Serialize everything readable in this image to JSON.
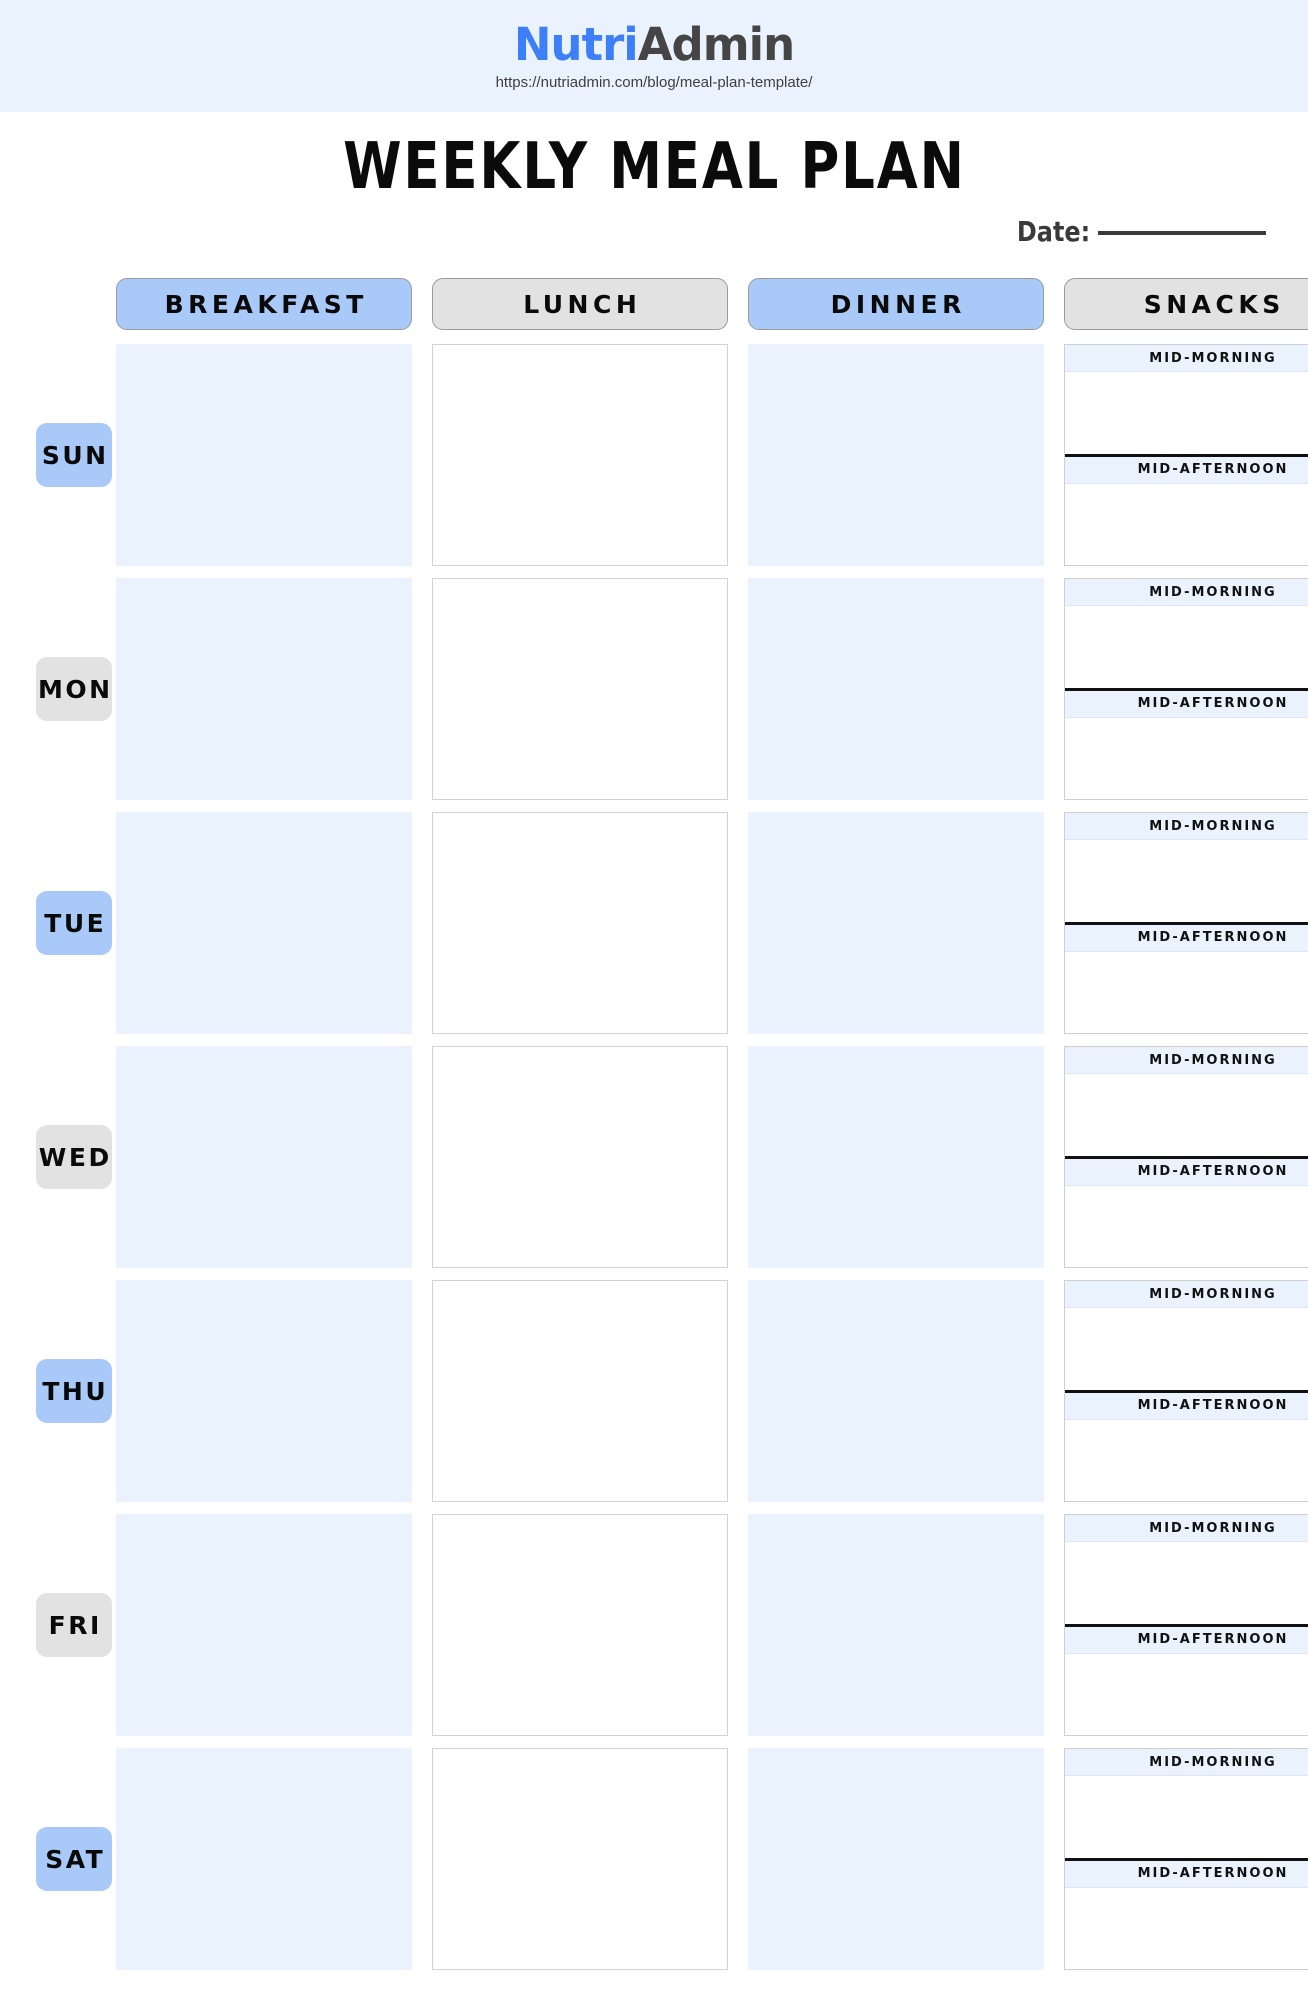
{
  "banner": {
    "brand_first": "Nutri",
    "brand_second": "Admin",
    "url": "https://nutriadmin.com/blog/meal-plan-template/",
    "background_color": "#eaf2fd",
    "brand_color": "#3d7ff9",
    "brand_second_color": "#454545"
  },
  "title": "WEEKLY MEAL PLAN",
  "date_field": {
    "label": "Date:",
    "value": "",
    "placeholder": ""
  },
  "colors": {
    "accent_blue": "#a9c9f8",
    "cell_blue": "#eaf2fd",
    "accent_gray": "#e2e2e2",
    "divider_dark": "#111111"
  },
  "columns": [
    {
      "label": "BREAKFAST",
      "style": "blue",
      "cell_style": "blue"
    },
    {
      "label": "LUNCH",
      "style": "gray",
      "cell_style": "white"
    },
    {
      "label": "DINNER",
      "style": "blue",
      "cell_style": "blue"
    },
    {
      "label": "SNACKS",
      "style": "gray",
      "cell_style": "snacks"
    }
  ],
  "snack_sections": [
    {
      "label": "MID-MORNING",
      "value": ""
    },
    {
      "label": "MID-AFTERNOON",
      "value": ""
    }
  ],
  "days": [
    {
      "label": "SUN",
      "style": "blue",
      "breakfast": "",
      "lunch": "",
      "dinner": "",
      "mid_morning": "",
      "mid_afternoon": ""
    },
    {
      "label": "MON",
      "style": "gray",
      "breakfast": "",
      "lunch": "",
      "dinner": "",
      "mid_morning": "",
      "mid_afternoon": ""
    },
    {
      "label": "TUE",
      "style": "blue",
      "breakfast": "",
      "lunch": "",
      "dinner": "",
      "mid_morning": "",
      "mid_afternoon": ""
    },
    {
      "label": "WED",
      "style": "gray",
      "breakfast": "",
      "lunch": "",
      "dinner": "",
      "mid_morning": "",
      "mid_afternoon": ""
    },
    {
      "label": "THU",
      "style": "blue",
      "breakfast": "",
      "lunch": "",
      "dinner": "",
      "mid_morning": "",
      "mid_afternoon": ""
    },
    {
      "label": "FRI",
      "style": "gray",
      "breakfast": "",
      "lunch": "",
      "dinner": "",
      "mid_morning": "",
      "mid_afternoon": ""
    },
    {
      "label": "SAT",
      "style": "blue",
      "breakfast": "",
      "lunch": "",
      "dinner": "",
      "mid_morning": "",
      "mid_afternoon": ""
    }
  ]
}
